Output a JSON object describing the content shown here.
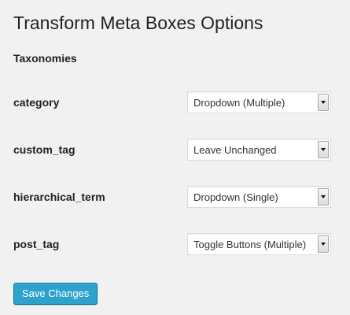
{
  "page": {
    "title": "Transform Meta Boxes Options",
    "section_title": "Taxonomies"
  },
  "taxonomies": [
    {
      "label": "category",
      "selected": "Dropdown (Multiple)"
    },
    {
      "label": "custom_tag",
      "selected": "Leave Unchanged"
    },
    {
      "label": "hierarchical_term",
      "selected": "Dropdown (Single)"
    },
    {
      "label": "post_tag",
      "selected": "Toggle Buttons (Multiple)"
    }
  ],
  "actions": {
    "save_label": "Save Changes"
  },
  "colors": {
    "background": "#f1f1f1",
    "primary_button": "#2ea2cc",
    "primary_button_border": "#0074a2"
  }
}
